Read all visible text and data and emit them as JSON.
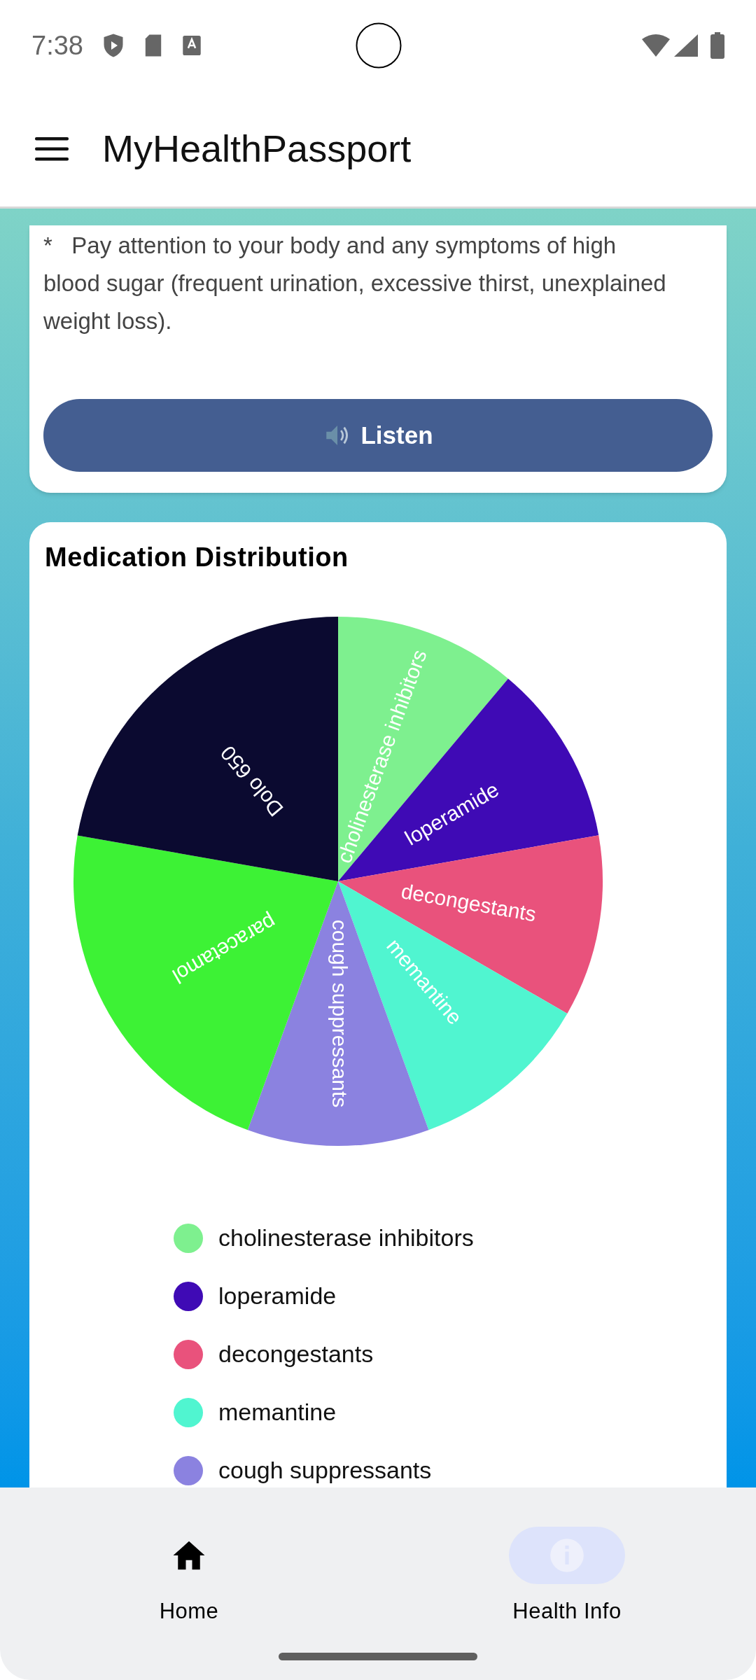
{
  "status_bar": {
    "time": "7:38"
  },
  "app_bar": {
    "title": "MyHealthPassport"
  },
  "advice_card": {
    "text": "*   Pay attention to your body and any symptoms of high blood sugar (frequent urination, excessive thirst, unexplained weight loss).",
    "button": "Listen"
  },
  "chart_card": {
    "chart_data": {
      "type": "pie",
      "title": "Medication Distribution",
      "categories": [
        "cholinesterase inhibitors",
        "loperamide",
        "decongestants",
        "memantine",
        "cough suppressants",
        "paracetamol",
        "Dolo 650"
      ],
      "series": [
        {
          "values": [
            11.11,
            11.11,
            11.11,
            11.11,
            11.11,
            22.22,
            22.23
          ]
        }
      ],
      "colors": [
        "#7ef08f",
        "#3f0ab5",
        "#e9527c",
        "#50f5d0",
        "#8b82e0",
        "#3df235",
        "#0b0a30"
      ]
    },
    "legend": [
      {
        "label": "cholinesterase inhibitors",
        "color": "#7ef08f"
      },
      {
        "label": "loperamide",
        "color": "#3f0ab5"
      },
      {
        "label": "decongestants",
        "color": "#e9527c"
      },
      {
        "label": "memantine",
        "color": "#50f5d0"
      },
      {
        "label": "cough suppressants",
        "color": "#8b82e0"
      }
    ]
  },
  "bottom_nav": [
    {
      "label": "Home",
      "kind": "home",
      "selected": false
    },
    {
      "label": "Health Info",
      "kind": "info",
      "selected": true
    }
  ]
}
